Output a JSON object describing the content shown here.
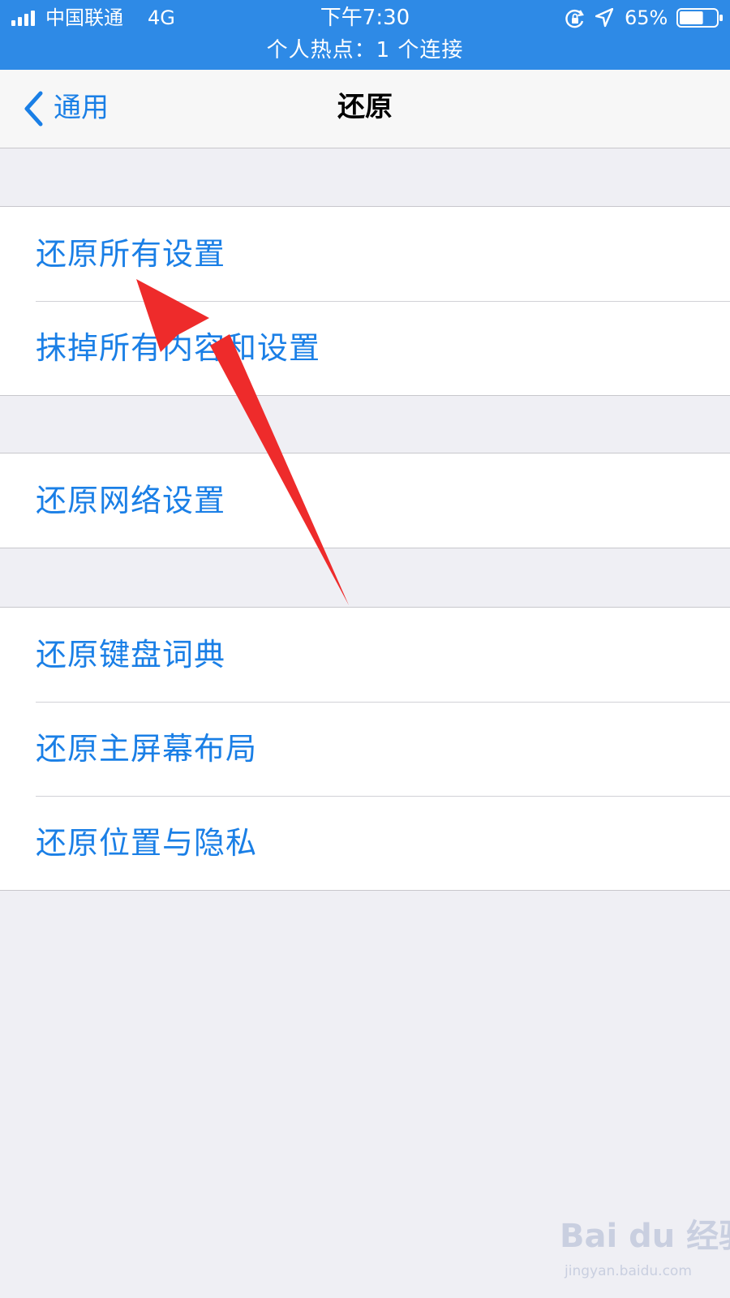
{
  "status_bar": {
    "carrier": "中国联通",
    "network": "4G",
    "time": "下午7:30",
    "battery_percent": "65%",
    "battery_level": 0.65,
    "hotspot_text": "个人热点：1 个连接",
    "bar_color": "#2e8ae6",
    "icons": [
      "signal-icon",
      "rotation-lock-icon",
      "location-icon",
      "battery-icon"
    ]
  },
  "nav": {
    "back_label": "通用",
    "title": "还原"
  },
  "groups": [
    {
      "items": [
        {
          "label": "还原所有设置"
        },
        {
          "label": "抹掉所有内容和设置"
        }
      ]
    },
    {
      "items": [
        {
          "label": "还原网络设置"
        }
      ]
    },
    {
      "items": [
        {
          "label": "还原键盘词典"
        },
        {
          "label": "还原主屏幕布局"
        },
        {
          "label": "还原位置与隐私"
        }
      ]
    }
  ],
  "annotation": {
    "type": "arrow",
    "color": "#ee2b2b",
    "points_to": "还原所有设置"
  },
  "watermark": {
    "brand": "Bai du 经验",
    "url": "jingyan.baidu.com"
  },
  "colors": {
    "accent": "#1a7fe6",
    "background": "#efeff4",
    "separator": "#c8c7cc"
  }
}
